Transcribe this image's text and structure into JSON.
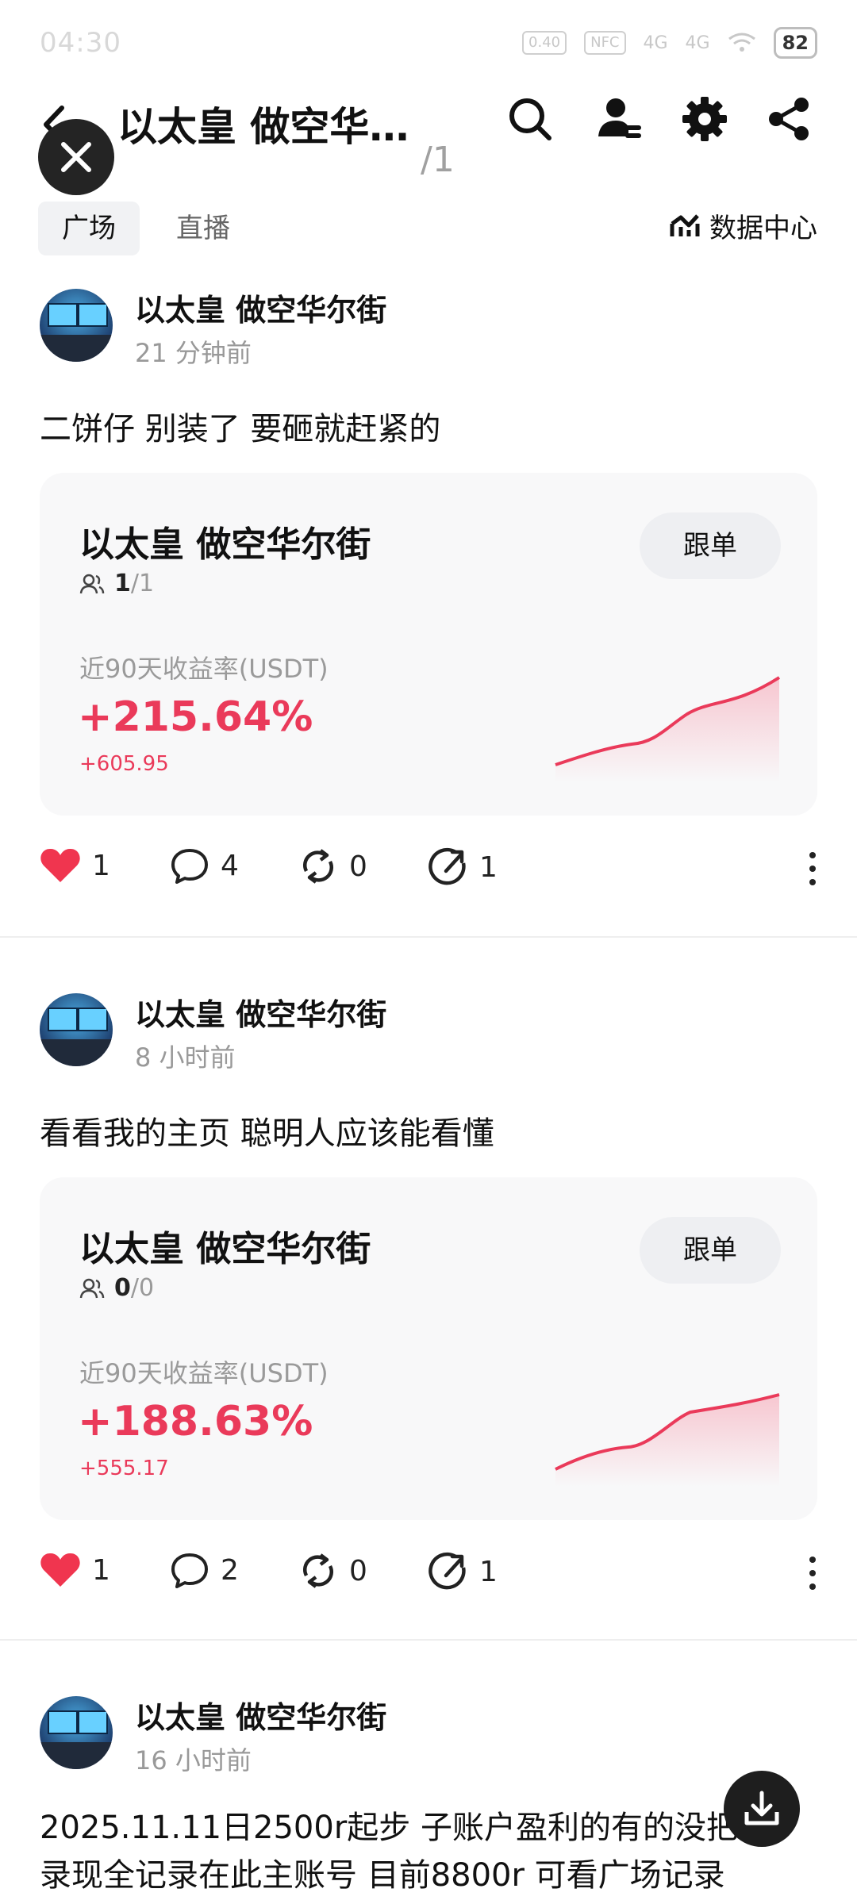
{
  "status_bar": {
    "time": "04:30",
    "battery": "82",
    "chips": [
      "0.40",
      "NFC",
      "4G",
      "4G"
    ]
  },
  "header": {
    "title": "以太皇 做空华…",
    "page_indicator": "/1"
  },
  "tabs": [
    {
      "label": "广场"
    },
    {
      "label": "直播"
    }
  ],
  "data_center_label": "数据中心",
  "posts": [
    {
      "author": "以太皇 做空华尔街",
      "time": "21 分钟前",
      "text": "二饼仔 别装了 要砸就赶紧的",
      "card": {
        "title": "以太皇 做空华尔街",
        "follow_label": "跟单",
        "followers_current": "1",
        "followers_total": "/1",
        "roi_label": "近90天收益率(USDT)",
        "roi": "+215.64%",
        "pnl": "+605.95"
      },
      "likes": "1",
      "comments": "4",
      "reposts": "0",
      "shares": "1"
    },
    {
      "author": "以太皇 做空华尔街",
      "time": "8 小时前",
      "text": "看看我的主页 聪明人应该能看懂",
      "card": {
        "title": "以太皇 做空华尔街",
        "follow_label": "跟单",
        "followers_current": "0",
        "followers_total": "/0",
        "roi_label": "近90天收益率(USDT)",
        "roi": "+188.63%",
        "pnl": "+555.17"
      },
      "likes": "1",
      "comments": "2",
      "reposts": "0",
      "shares": "1"
    },
    {
      "author": "以太皇 做空华尔街",
      "time": "16 小时前",
      "text_line1": "2025.11.11日2500r起步 子账户盈利的有的没把",
      "text_line2": "录现全记录在此主账号 目前8800r 可看广场记录"
    }
  ],
  "colors": {
    "accent_red": "#ea3a5a",
    "like_red": "#f0354f"
  }
}
